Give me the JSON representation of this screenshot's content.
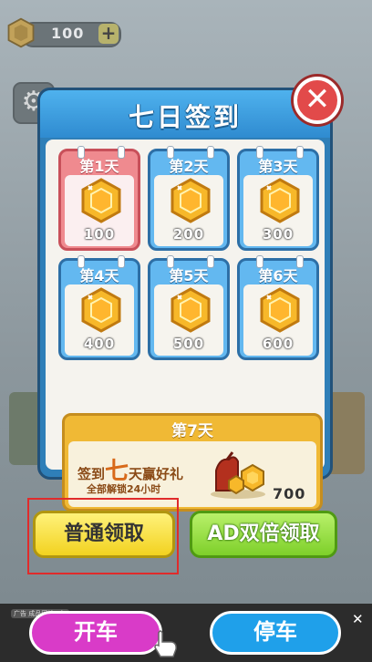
{
  "hud": {
    "coins": "100",
    "plus_label": "+"
  },
  "dialog": {
    "title": "七日签到",
    "close_label": "✕",
    "days": [
      {
        "label": "第1天",
        "amount": "100",
        "active": true
      },
      {
        "label": "第2天",
        "amount": "200",
        "active": false
      },
      {
        "label": "第3天",
        "amount": "300",
        "active": false
      },
      {
        "label": "第4天",
        "amount": "400",
        "active": false
      },
      {
        "label": "第5天",
        "amount": "500",
        "active": false
      },
      {
        "label": "第6天",
        "amount": "600",
        "active": false
      }
    ],
    "day7": {
      "label": "第7天",
      "promo_pre": "签到",
      "promo_big": "七",
      "promo_post": "天赢好礼",
      "sub": "全部解锁24小时",
      "amount": "700"
    }
  },
  "buttons": {
    "normal": "普通领取",
    "ad": "AD双倍领取"
  },
  "ad_bar": {
    "tag": "广告 成品网站 1年",
    "go": "开车",
    "stop": "停车",
    "close": "✕"
  },
  "colors": {
    "coin": "#f7b82a",
    "active_card": "#ef8a8f",
    "card": "#63b8f0",
    "title_bar": "#3fa2e2",
    "highlight": "#e02b2b"
  }
}
